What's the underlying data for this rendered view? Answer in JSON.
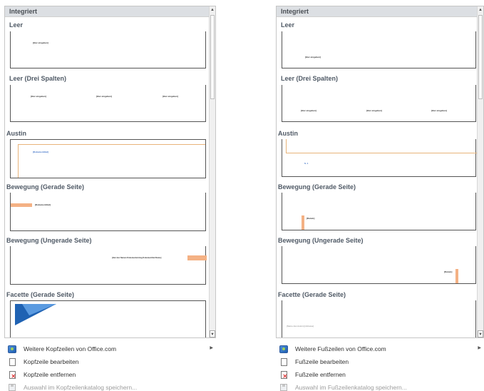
{
  "left": {
    "gallery_header": "Integriert",
    "items": [
      {
        "title": "Leer",
        "placeholders": [
          "[Hier eingeben]"
        ]
      },
      {
        "title": "Leer (Drei Spalten)",
        "placeholders": [
          "[Hier eingeben]",
          "[Hier eingeben]",
          "[Hier eingeben]"
        ]
      },
      {
        "title": "Austin",
        "placeholders": [
          "[Dokumenttitel]"
        ]
      },
      {
        "title": "Bewegung (Gerade Seite)",
        "placeholders": [
          "[Dokumenttitel]"
        ]
      },
      {
        "title": "Bewegung (Ungerade Seite)",
        "placeholders": [
          "[Hier den Namen Dokumenteintrag Dokumenttitel Name]"
        ]
      },
      {
        "title": "Facette (Gerade Seite)",
        "placeholders": []
      }
    ],
    "menu": [
      {
        "label": "Weitere Kopfzeilen von Office.com",
        "icon": "office-globe-icon",
        "disabled": false,
        "submenu": true
      },
      {
        "label": "Kopfzeile bearbeiten",
        "icon": "document-icon",
        "disabled": false,
        "submenu": false
      },
      {
        "label": "Kopfzeile entfernen",
        "icon": "remove-document-icon",
        "disabled": false,
        "submenu": false
      },
      {
        "label": "Auswahl im Kopfzeilenkatalog speichern...",
        "icon": "save-selection-icon",
        "disabled": true,
        "submenu": false
      }
    ]
  },
  "right": {
    "gallery_header": "Integriert",
    "items": [
      {
        "title": "Leer",
        "placeholders": [
          "[Hier eingeben]"
        ]
      },
      {
        "title": "Leer (Drei Spalten)",
        "placeholders": [
          "[Hier eingeben]",
          "[Hier eingeben]",
          "[Hier eingeben]"
        ]
      },
      {
        "title": "Austin",
        "placeholders": [
          "S. 1"
        ]
      },
      {
        "title": "Bewegung (Gerade Seite)",
        "placeholders": [
          "[Datum]"
        ]
      },
      {
        "title": "Bewegung (Ungerade Seite)",
        "placeholders": [
          "[Datum]"
        ]
      },
      {
        "title": "Facette (Gerade Seite)",
        "placeholders": [
          "[Name des Autors] [Adresse]"
        ]
      }
    ],
    "menu": [
      {
        "label": "Weitere Fußzeilen von Office.com",
        "icon": "office-globe-icon",
        "disabled": false,
        "submenu": true
      },
      {
        "label": "Fußzeile bearbeiten",
        "icon": "document-icon",
        "disabled": false,
        "submenu": false
      },
      {
        "label": "Fußzeile entfernen",
        "icon": "remove-document-icon",
        "disabled": false,
        "submenu": false
      },
      {
        "label": "Auswahl im Fußzeilenkatalog speichern...",
        "icon": "save-selection-icon",
        "disabled": true,
        "submenu": false
      }
    ]
  },
  "colors": {
    "accent_orange": "#f4b184",
    "austin_line": "#e8b47a",
    "facette_blue": "#1f62b3",
    "header_bg": "#dcdfe3"
  }
}
